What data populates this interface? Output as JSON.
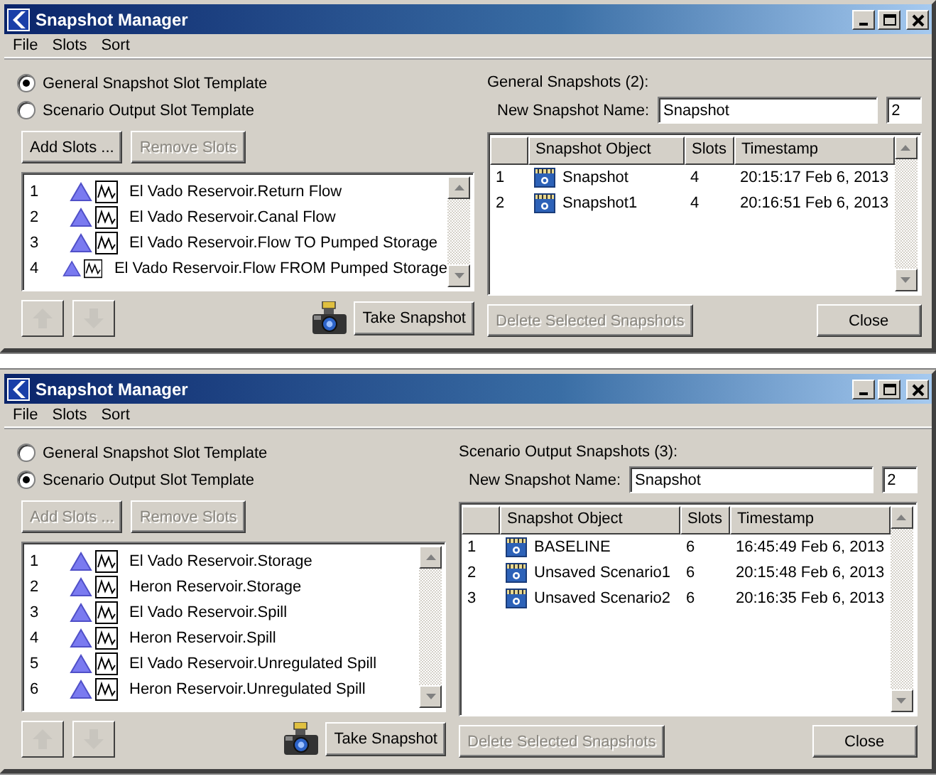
{
  "windows": [
    {
      "title": "Snapshot Manager",
      "menu": [
        "File",
        "Slots",
        "Sort"
      ],
      "templates": [
        {
          "label": "General Snapshot Slot Template",
          "selected": true
        },
        {
          "label": "Scenario Output Slot Template",
          "selected": false
        }
      ],
      "add_slots": {
        "label": "Add Slots ...",
        "disabled": false
      },
      "remove_slots": {
        "label": "Remove Slots",
        "disabled": true
      },
      "slots": [
        {
          "number": "1",
          "name": "El Vado Reservoir.Return Flow"
        },
        {
          "number": "2",
          "name": "El Vado Reservoir.Canal Flow"
        },
        {
          "number": "3",
          "name": "El Vado Reservoir.Flow TO Pumped Storage"
        },
        {
          "number": "4",
          "name": "El Vado Reservoir.Flow FROM Pumped Storage"
        }
      ],
      "move_up": {
        "disabled": true
      },
      "move_down": {
        "disabled": true
      },
      "take_snapshot": {
        "label": "Take Snapshot",
        "disabled": false
      },
      "snapshots_heading": "General Snapshots (2):",
      "new_name_label": "New Snapshot Name:",
      "new_name": "Snapshot",
      "counter": "2",
      "columns": [
        "Snapshot Object",
        "Slots",
        "Timestamp"
      ],
      "snapshots": [
        {
          "number": "1",
          "object": "Snapshot",
          "slots": "4",
          "timestamp": "20:15:17 Feb 6, 2013"
        },
        {
          "number": "2",
          "object": "Snapshot1",
          "slots": "4",
          "timestamp": "20:16:51 Feb 6, 2013"
        }
      ],
      "delete_selected": {
        "label": "Delete Selected Snapshots",
        "disabled": true
      },
      "close": {
        "label": "Close",
        "disabled": false
      }
    },
    {
      "title": "Snapshot Manager",
      "menu": [
        "File",
        "Slots",
        "Sort"
      ],
      "templates": [
        {
          "label": "General Snapshot Slot Template",
          "selected": false
        },
        {
          "label": "Scenario Output Slot Template",
          "selected": true
        }
      ],
      "add_slots": {
        "label": "Add Slots ...",
        "disabled": true
      },
      "remove_slots": {
        "label": "Remove Slots",
        "disabled": true
      },
      "slots": [
        {
          "number": "1",
          "name": "El Vado Reservoir.Storage"
        },
        {
          "number": "2",
          "name": "Heron Reservoir.Storage"
        },
        {
          "number": "3",
          "name": "El Vado Reservoir.Spill"
        },
        {
          "number": "4",
          "name": "Heron Reservoir.Spill"
        },
        {
          "number": "5",
          "name": "El Vado Reservoir.Unregulated Spill"
        },
        {
          "number": "6",
          "name": "Heron Reservoir.Unregulated Spill"
        }
      ],
      "move_up": {
        "disabled": true
      },
      "move_down": {
        "disabled": true
      },
      "take_snapshot": {
        "label": "Take Snapshot",
        "disabled": false
      },
      "snapshots_heading": "Scenario Output Snapshots (3):",
      "new_name_label": "New Snapshot Name:",
      "new_name": "Snapshot",
      "counter": "2",
      "columns": [
        "Snapshot Object",
        "Slots",
        "Timestamp"
      ],
      "snapshots": [
        {
          "number": "1",
          "object": "BASELINE",
          "slots": "6",
          "timestamp": "16:45:49 Feb 6, 2013"
        },
        {
          "number": "2",
          "object": "Unsaved Scenario1",
          "slots": "6",
          "timestamp": "20:15:48 Feb 6, 2013"
        },
        {
          "number": "3",
          "object": "Unsaved Scenario2",
          "slots": "6",
          "timestamp": "20:16:35 Feb 6, 2013"
        }
      ],
      "delete_selected": {
        "label": "Delete Selected Snapshots",
        "disabled": true
      },
      "close": {
        "label": "Close",
        "disabled": false
      }
    }
  ]
}
